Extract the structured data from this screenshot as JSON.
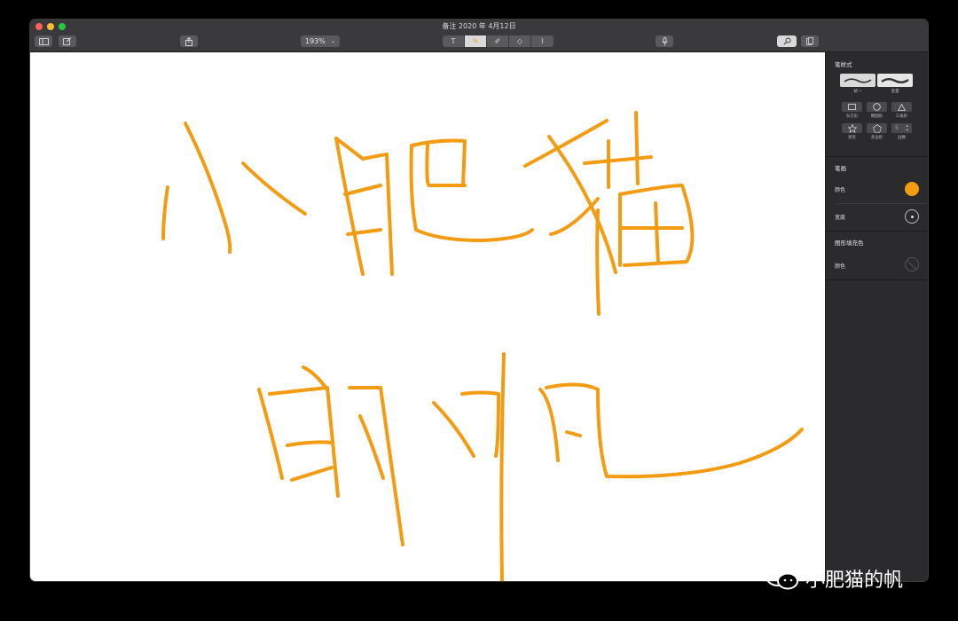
{
  "window": {
    "title": "备注 2020 年 4月12日"
  },
  "toolbar": {
    "zoom_value": "193%",
    "tools": [
      {
        "name": "text-tool",
        "glyph": "T",
        "active": false
      },
      {
        "name": "marker-tool",
        "glyph": "✎",
        "active": true
      },
      {
        "name": "highlighter-tool",
        "glyph": "✐",
        "active": false
      },
      {
        "name": "eraser-tool",
        "glyph": "◇",
        "active": false
      },
      {
        "name": "lasso-tool",
        "glyph": "⌇",
        "active": false
      }
    ]
  },
  "inspector": {
    "pen_style": {
      "title": "笔样式",
      "uniform_label": "统一",
      "variable_label": "变量"
    },
    "shapes": [
      {
        "label": "长方形",
        "icon": "rectangle-icon"
      },
      {
        "label": "椭圆形",
        "icon": "ellipse-icon"
      },
      {
        "label": "三角形",
        "icon": "triangle-icon"
      },
      {
        "label": "星形",
        "icon": "star-icon"
      },
      {
        "label": "多边形",
        "icon": "pentagon-icon"
      },
      {
        "label": "边数",
        "icon": "stepper-icon",
        "value": "5"
      }
    ],
    "stroke": {
      "title": "笔画",
      "color_label": "颜色",
      "color_value": "#f39c12",
      "width_label": "宽度"
    },
    "fill": {
      "title": "图形填充色",
      "color_label": "颜色"
    }
  },
  "watermark": {
    "text": "小肥猫的帆"
  },
  "colors": {
    "ink": "#f39c12",
    "canvas": "#ffffff",
    "panel": "#2b2b2d"
  }
}
